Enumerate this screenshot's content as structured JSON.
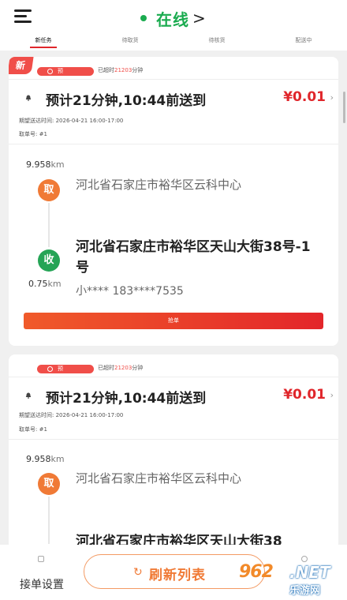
{
  "header": {
    "status_label": "在线",
    "chevron": ">",
    "status_color": "#1aab4f"
  },
  "tabs": [
    "新任务",
    "待取货",
    "待核货",
    "配送中"
  ],
  "orders": [
    {
      "new_badge": "新",
      "pre_badge": "预",
      "overtime_prefix": "已超时",
      "overtime_minutes": "21203",
      "overtime_suffix": "分钟",
      "eta": "预计21分钟,10:44前送到",
      "price": "¥0.01",
      "expected_time": "期望送达时间: 2026-04-21 16:00-17:00",
      "pickup_no": "取单号: #1",
      "pickup_distance": "9.958",
      "pickup_unit": "km",
      "pickup_label": "取",
      "pickup_address": "河北省石家庄市裕华区云科中心",
      "drop_label": "收",
      "drop_distance": "0.75",
      "drop_unit": "km",
      "drop_address": "河北省石家庄市裕华区天山大街38号-1号",
      "contact": "小**** 183****7535",
      "grab_label": "抢单"
    },
    {
      "pre_badge": "预",
      "overtime_prefix": "已超时",
      "overtime_minutes": "21203",
      "overtime_suffix": "分钟",
      "eta": "预计21分钟,10:44前送到",
      "price": "¥0.01",
      "expected_time": "期望送达时间: 2026-04-21 16:00-17:00",
      "pickup_no": "取单号: #1",
      "pickup_distance": "9.958",
      "pickup_unit": "km",
      "pickup_label": "取",
      "pickup_address": "河北省石家庄市裕华区云科中心",
      "drop_address": "河北省石家庄市裕华区天山大街38"
    }
  ],
  "bottom": {
    "settings_label": "接单设置",
    "refresh_label": "刷新列表",
    "refresh_icon": "refresh-icon"
  },
  "watermark": {
    "brand": "962",
    "net": ".NET",
    "sub": "乐游网"
  },
  "colors": {
    "accent_red": "#e0262b",
    "pickup_orange": "#f07a36",
    "drop_green": "#25a456"
  }
}
